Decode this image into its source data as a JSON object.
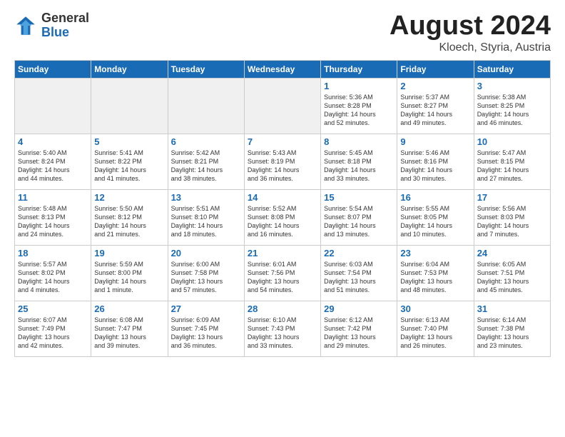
{
  "logo": {
    "general": "General",
    "blue": "Blue"
  },
  "title": {
    "month_year": "August 2024",
    "location": "Kloech, Styria, Austria"
  },
  "weekdays": [
    "Sunday",
    "Monday",
    "Tuesday",
    "Wednesday",
    "Thursday",
    "Friday",
    "Saturday"
  ],
  "weeks": [
    [
      {
        "day": "",
        "info": ""
      },
      {
        "day": "",
        "info": ""
      },
      {
        "day": "",
        "info": ""
      },
      {
        "day": "",
        "info": ""
      },
      {
        "day": "1",
        "info": "Sunrise: 5:36 AM\nSunset: 8:28 PM\nDaylight: 14 hours\nand 52 minutes."
      },
      {
        "day": "2",
        "info": "Sunrise: 5:37 AM\nSunset: 8:27 PM\nDaylight: 14 hours\nand 49 minutes."
      },
      {
        "day": "3",
        "info": "Sunrise: 5:38 AM\nSunset: 8:25 PM\nDaylight: 14 hours\nand 46 minutes."
      }
    ],
    [
      {
        "day": "4",
        "info": "Sunrise: 5:40 AM\nSunset: 8:24 PM\nDaylight: 14 hours\nand 44 minutes."
      },
      {
        "day": "5",
        "info": "Sunrise: 5:41 AM\nSunset: 8:22 PM\nDaylight: 14 hours\nand 41 minutes."
      },
      {
        "day": "6",
        "info": "Sunrise: 5:42 AM\nSunset: 8:21 PM\nDaylight: 14 hours\nand 38 minutes."
      },
      {
        "day": "7",
        "info": "Sunrise: 5:43 AM\nSunset: 8:19 PM\nDaylight: 14 hours\nand 36 minutes."
      },
      {
        "day": "8",
        "info": "Sunrise: 5:45 AM\nSunset: 8:18 PM\nDaylight: 14 hours\nand 33 minutes."
      },
      {
        "day": "9",
        "info": "Sunrise: 5:46 AM\nSunset: 8:16 PM\nDaylight: 14 hours\nand 30 minutes."
      },
      {
        "day": "10",
        "info": "Sunrise: 5:47 AM\nSunset: 8:15 PM\nDaylight: 14 hours\nand 27 minutes."
      }
    ],
    [
      {
        "day": "11",
        "info": "Sunrise: 5:48 AM\nSunset: 8:13 PM\nDaylight: 14 hours\nand 24 minutes."
      },
      {
        "day": "12",
        "info": "Sunrise: 5:50 AM\nSunset: 8:12 PM\nDaylight: 14 hours\nand 21 minutes."
      },
      {
        "day": "13",
        "info": "Sunrise: 5:51 AM\nSunset: 8:10 PM\nDaylight: 14 hours\nand 18 minutes."
      },
      {
        "day": "14",
        "info": "Sunrise: 5:52 AM\nSunset: 8:08 PM\nDaylight: 14 hours\nand 16 minutes."
      },
      {
        "day": "15",
        "info": "Sunrise: 5:54 AM\nSunset: 8:07 PM\nDaylight: 14 hours\nand 13 minutes."
      },
      {
        "day": "16",
        "info": "Sunrise: 5:55 AM\nSunset: 8:05 PM\nDaylight: 14 hours\nand 10 minutes."
      },
      {
        "day": "17",
        "info": "Sunrise: 5:56 AM\nSunset: 8:03 PM\nDaylight: 14 hours\nand 7 minutes."
      }
    ],
    [
      {
        "day": "18",
        "info": "Sunrise: 5:57 AM\nSunset: 8:02 PM\nDaylight: 14 hours\nand 4 minutes."
      },
      {
        "day": "19",
        "info": "Sunrise: 5:59 AM\nSunset: 8:00 PM\nDaylight: 14 hours\nand 1 minute."
      },
      {
        "day": "20",
        "info": "Sunrise: 6:00 AM\nSunset: 7:58 PM\nDaylight: 13 hours\nand 57 minutes."
      },
      {
        "day": "21",
        "info": "Sunrise: 6:01 AM\nSunset: 7:56 PM\nDaylight: 13 hours\nand 54 minutes."
      },
      {
        "day": "22",
        "info": "Sunrise: 6:03 AM\nSunset: 7:54 PM\nDaylight: 13 hours\nand 51 minutes."
      },
      {
        "day": "23",
        "info": "Sunrise: 6:04 AM\nSunset: 7:53 PM\nDaylight: 13 hours\nand 48 minutes."
      },
      {
        "day": "24",
        "info": "Sunrise: 6:05 AM\nSunset: 7:51 PM\nDaylight: 13 hours\nand 45 minutes."
      }
    ],
    [
      {
        "day": "25",
        "info": "Sunrise: 6:07 AM\nSunset: 7:49 PM\nDaylight: 13 hours\nand 42 minutes."
      },
      {
        "day": "26",
        "info": "Sunrise: 6:08 AM\nSunset: 7:47 PM\nDaylight: 13 hours\nand 39 minutes."
      },
      {
        "day": "27",
        "info": "Sunrise: 6:09 AM\nSunset: 7:45 PM\nDaylight: 13 hours\nand 36 minutes."
      },
      {
        "day": "28",
        "info": "Sunrise: 6:10 AM\nSunset: 7:43 PM\nDaylight: 13 hours\nand 33 minutes."
      },
      {
        "day": "29",
        "info": "Sunrise: 6:12 AM\nSunset: 7:42 PM\nDaylight: 13 hours\nand 29 minutes."
      },
      {
        "day": "30",
        "info": "Sunrise: 6:13 AM\nSunset: 7:40 PM\nDaylight: 13 hours\nand 26 minutes."
      },
      {
        "day": "31",
        "info": "Sunrise: 6:14 AM\nSunset: 7:38 PM\nDaylight: 13 hours\nand 23 minutes."
      }
    ]
  ]
}
